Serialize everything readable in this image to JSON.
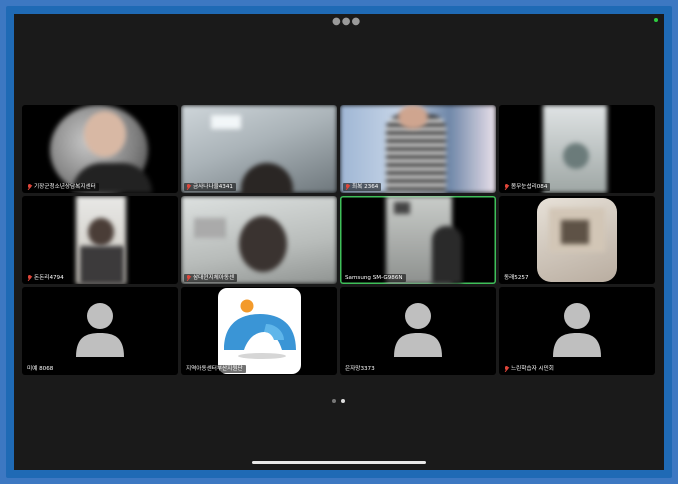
{
  "window": {
    "top_menu_icon": "more-dots-icon",
    "status_indicator_color": "#2ecc40"
  },
  "participants": [
    {
      "name": "기장군청소년상담복지센터",
      "muted": true
    },
    {
      "name": "금사나나율4341",
      "muted": true
    },
    {
      "name": "최복 2364",
      "muted": true
    },
    {
      "name": "몸무눈섭리084",
      "muted": true
    },
    {
      "name": "돈돈리4794",
      "muted": true
    },
    {
      "name": "삼대현지체아동센",
      "muted": true
    },
    {
      "name": "Samsung SM-G986N",
      "muted": false,
      "active_speaker": true
    },
    {
      "name": "동래5257",
      "muted": false
    },
    {
      "name": "미예 8068",
      "muted": false
    },
    {
      "name": "지역아동센터부산지원단",
      "muted": false
    },
    {
      "name": "은자망3373",
      "muted": false
    },
    {
      "name": "느린학습자 시민회",
      "muted": true
    }
  ],
  "pagination": {
    "current_page": 2,
    "total_pages": 2
  },
  "colors": {
    "accent_active_border": "#3fbf5a",
    "muted_mic": "#e0463a",
    "frame": "#1f6ab5"
  }
}
